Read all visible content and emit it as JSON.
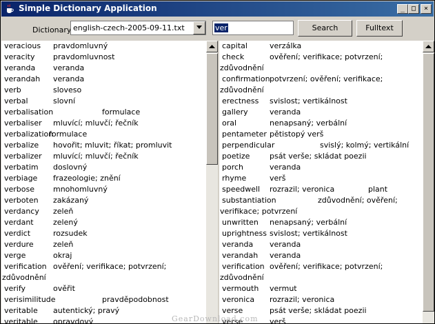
{
  "window": {
    "title": "Simple Dictionary Application",
    "minimize": "_",
    "maximize": "□",
    "close": "×"
  },
  "toolbar": {
    "dictionary_label": "Dictionary",
    "dictionary_value": "english-czech-2005-09-11.txt",
    "search_value": "ver",
    "search_button": "Search",
    "fulltext_button": "Fulltext"
  },
  "left_list": [
    {
      "word": "veracious",
      "translation": "pravdomluvný"
    },
    {
      "word": "veracity",
      "translation": "pravdomluvnost"
    },
    {
      "word": "veranda",
      "translation": "veranda"
    },
    {
      "word": "verandah",
      "translation": "veranda"
    },
    {
      "word": "verb",
      "translation": "sloveso"
    },
    {
      "word": "verbal",
      "translation": "slovní"
    },
    {
      "word": "verbalisation",
      "translation": "formulace"
    },
    {
      "word": "verbaliser",
      "translation": "mluvící; mluvčí; řečník"
    },
    {
      "word": "verbalization",
      "translation": "formulace"
    },
    {
      "word": "verbalize",
      "translation": "hovořit; mluvit; říkat; promluvit"
    },
    {
      "word": "verbalizer",
      "translation": "mluvící; mluvčí; řečník"
    },
    {
      "word": "verbatim",
      "translation": "doslovný"
    },
    {
      "word": "verbiage",
      "translation": "frazeologie; znění"
    },
    {
      "word": "verbose",
      "translation": "mnohomluvný"
    },
    {
      "word": "verboten",
      "translation": "zakázaný"
    },
    {
      "word": "verdancy",
      "translation": "zeleň"
    },
    {
      "word": "verdant",
      "translation": "zelený"
    },
    {
      "word": "verdict",
      "translation": "rozsudek"
    },
    {
      "word": "verdure",
      "translation": "zeleň"
    },
    {
      "word": "verge",
      "translation": "okraj"
    },
    {
      "word": "verification",
      "translation": "ověření; verifikace; potvrzení;",
      "continued": "zdůvodnění"
    },
    {
      "word": "verify",
      "translation": "ověřit"
    },
    {
      "word": "verisimilitude",
      "translation": "pravděpodobnost"
    },
    {
      "word": "veritable",
      "translation": "autentický; pravý"
    },
    {
      "word": "veritable",
      "translation": "opravdový"
    }
  ],
  "right_list": [
    {
      "word": "capital",
      "translation": "verzálka"
    },
    {
      "word": "check",
      "translation": "ověření; verifikace; potvrzení;",
      "continued": "zdůvodnění"
    },
    {
      "word": "confirmation",
      "translation": "potvrzení; ověření; verifikace;",
      "continued": "zdůvodnění"
    },
    {
      "word": "erectness",
      "translation": "svislost; vertikálnost"
    },
    {
      "word": "gallery",
      "translation": "veranda"
    },
    {
      "word": "oral",
      "translation": "nenapsaný; verbální"
    },
    {
      "word": "pentameter",
      "translation": "pětistopý verš"
    },
    {
      "word": "perpendicular",
      "translation": "svislý; kolmý; vertikální"
    },
    {
      "word": "poetize",
      "translation": "psát verše; skládat poezii"
    },
    {
      "word": "porch",
      "translation": "veranda"
    },
    {
      "word": "rhyme",
      "translation": "verš"
    },
    {
      "word": "speedwell",
      "translation": "rozrazil; veronica",
      "extra": "plant"
    },
    {
      "word": "substantiation",
      "translation": "zdůvodnění; ověření;",
      "continued": "verifikace; potvrzení"
    },
    {
      "word": "unwritten",
      "translation": "nenapsaný; verbální"
    },
    {
      "word": "uprightness",
      "translation": "svislost; vertikálnost"
    },
    {
      "word": "veranda",
      "translation": "veranda"
    },
    {
      "word": "verandah",
      "translation": "veranda"
    },
    {
      "word": "verification",
      "translation": "ověření; verifikace; potvrzení;",
      "continued": "zdůvodnění"
    },
    {
      "word": "vermouth",
      "translation": "vermut"
    },
    {
      "word": "veronica",
      "translation": "rozrazil; veronica"
    },
    {
      "word": "verse",
      "translation": "psát verše; skládat poezii"
    },
    {
      "word": "verse",
      "translation": "verš"
    }
  ],
  "watermark": "GearDownload.com",
  "colors": {
    "titlebar_start": "#0a246a",
    "titlebar_end": "#3a6ea5",
    "window_bg": "#d4d0c8",
    "selection": "#0a246a"
  },
  "icons": {
    "app": "java-cup-icon",
    "dropdown": "triangle-down-icon",
    "scroll_up": "triangle-up-icon"
  }
}
